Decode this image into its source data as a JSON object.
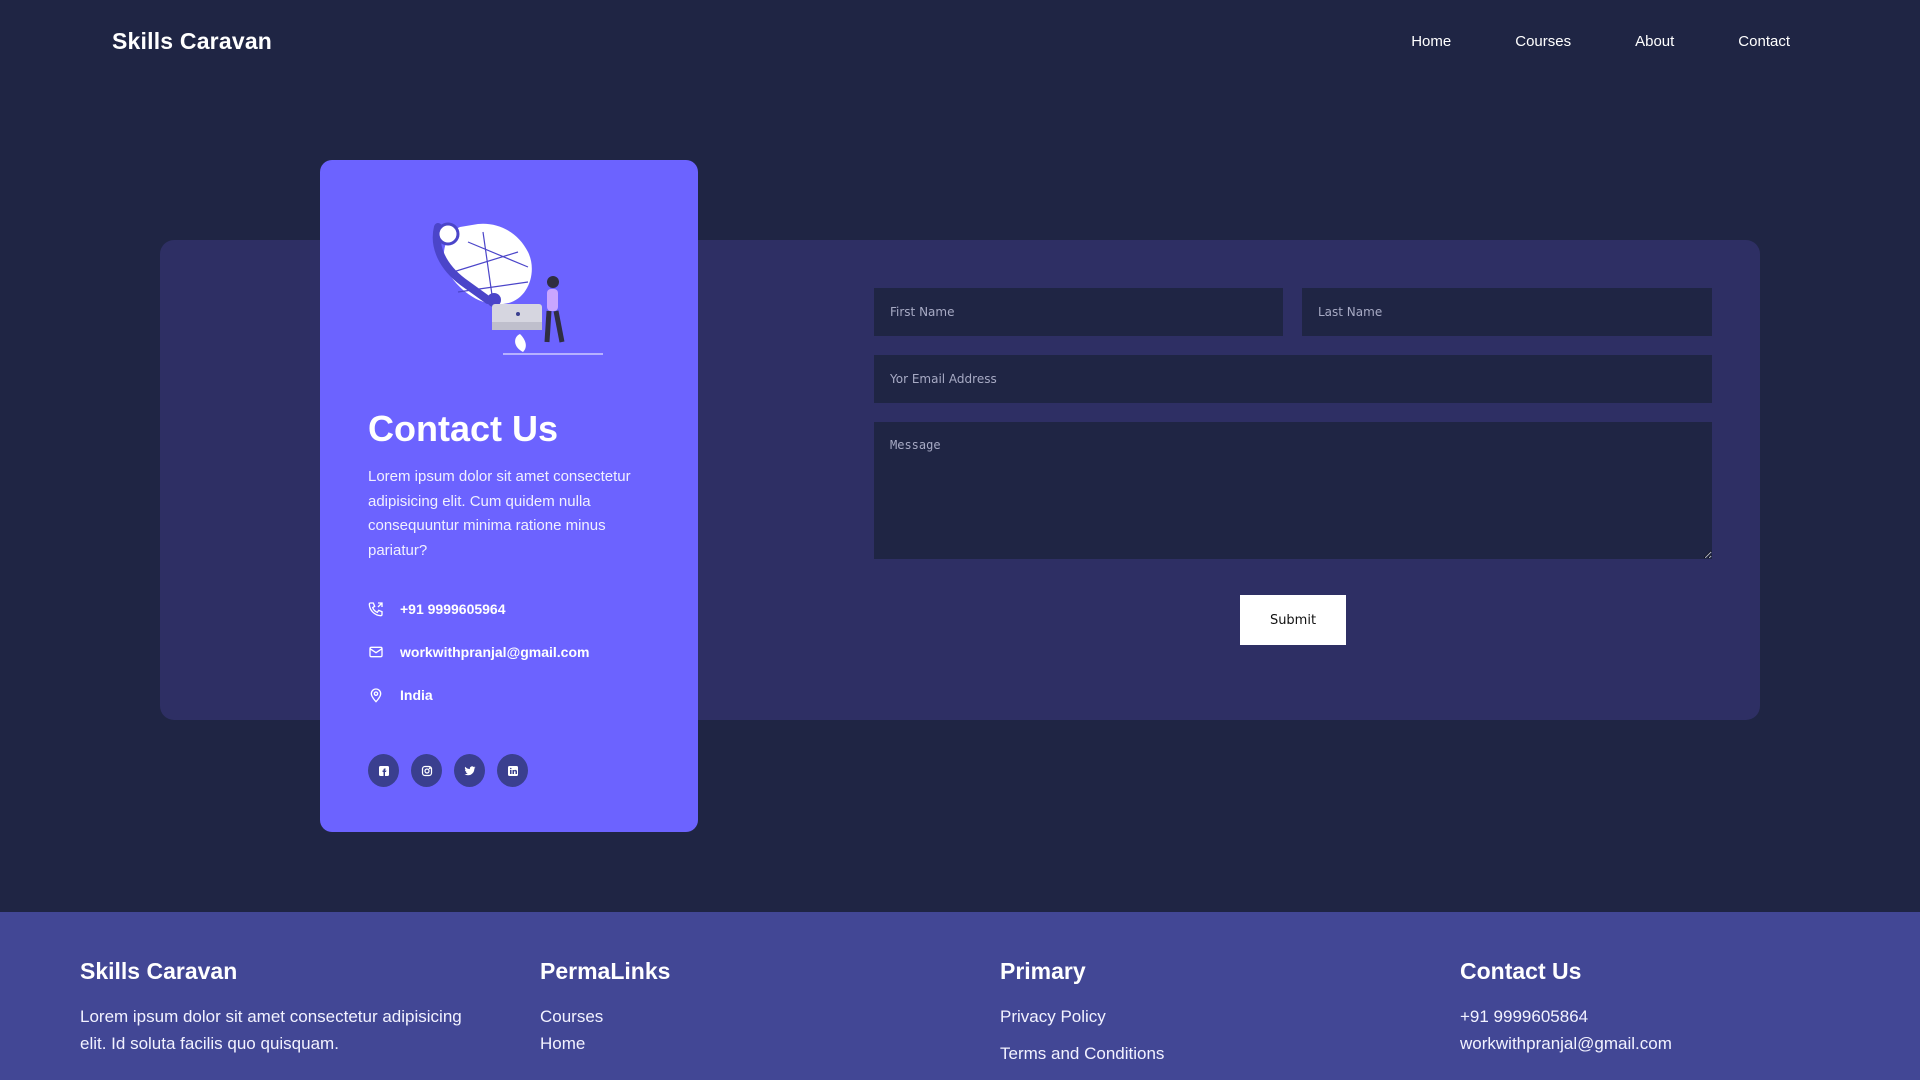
{
  "navbar": {
    "brand": "Skills Caravan",
    "links": [
      "Home",
      "Courses",
      "About",
      "Contact"
    ]
  },
  "contact_card": {
    "title": "Contact Us",
    "description": "Lorem ipsum dolor sit amet consectetur adipisicing elit. Cum quidem nulla consequuntur minima ratione minus pariatur?",
    "phone": "+91 9999605964",
    "email": "workwithpranjal@gmail.com",
    "location": "India",
    "socials": [
      "facebook-icon",
      "instagram-icon",
      "twitter-icon",
      "linkedin-icon"
    ]
  },
  "form": {
    "first_name_placeholder": "First Name",
    "last_name_placeholder": "Last Name",
    "email_placeholder": "Yor Email Address",
    "message_placeholder": "Message",
    "submit_label": "Submit"
  },
  "footer": {
    "col1": {
      "heading": "Skills Caravan",
      "text": "Lorem ipsum dolor sit amet consectetur adipisicing elit. Id soluta facilis quo quisquam."
    },
    "col2": {
      "heading": "PermaLinks",
      "links": [
        "Courses",
        "Home"
      ]
    },
    "col3": {
      "heading": "Primary",
      "links": [
        "Privacy Policy",
        "Terms and Conditions"
      ]
    },
    "col4": {
      "heading": "Contact Us",
      "phone": "+91 9999605864",
      "email": "workwithpranjal@gmail.com"
    }
  },
  "colors": {
    "page_bg": "#1f2544",
    "panel_bg": "#2e2f64",
    "card_bg": "#6c63ff",
    "footer_bg": "#424795",
    "social_bg": "#3a3f8f"
  }
}
